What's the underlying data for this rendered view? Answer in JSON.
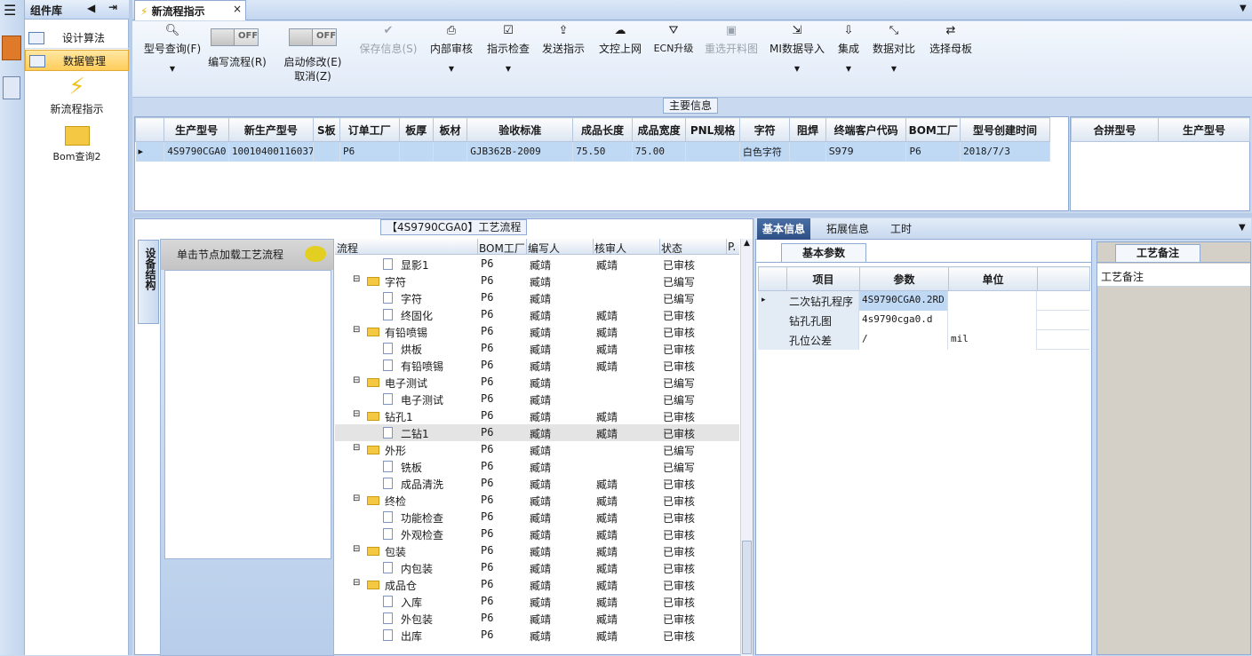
{
  "comp": {
    "title": "组件库",
    "nav": [
      "设计算法",
      "数据管理"
    ],
    "tiles": [
      "新流程指示",
      "Bom查询2"
    ]
  },
  "tab": {
    "title": "新流程指示",
    "close": "×"
  },
  "toolbar": {
    "query": "型号查询(F)",
    "write_flow": "编写流程(R)",
    "start_modify": "启动修改(E)",
    "cancel": "取消(Z)",
    "off": "OFF",
    "save": "保存信息(S)",
    "internal": "内部审核",
    "check": "指示检查",
    "send": "发送指示",
    "upload": "文控上网",
    "ecn": "ECN升级",
    "reselect": "重选开料图",
    "mi_import": "MI数据导入",
    "integrate": "集成",
    "compare": "数据对比",
    "mother": "选择母板"
  },
  "main_info": {
    "title": "主要信息",
    "headers": [
      "生产型号",
      "新生产型号",
      "S板",
      "订单工厂",
      "板厚",
      "板材",
      "验收标准",
      "成品长度",
      "成品宽度",
      "PNL规格",
      "字符",
      "阻焊",
      "终端客户代码",
      "BOM工厂",
      "型号创建时间"
    ],
    "row": [
      "4S9790CGA0",
      "10010400116037",
      "",
      "P6",
      "",
      "",
      "GJB362B-2009",
      "75.50",
      "75.00",
      "",
      "白色字符",
      "",
      "S979",
      "P6",
      "2018/7/3"
    ],
    "right_headers": [
      "合拼型号",
      "生产型号"
    ]
  },
  "process": {
    "title": "【4S9790CGA0】工艺流程",
    "vtab": "设备结构",
    "node_btn": "单击节点加载工艺流程",
    "headers": [
      "流程",
      "BOM工厂",
      "编写人",
      "核审人",
      "状态",
      "P."
    ],
    "rows": [
      {
        "lvl": 2,
        "name": "显影1",
        "bom": "P6",
        "w": "臧靖",
        "r": "臧靖",
        "s": "已审核"
      },
      {
        "lvl": 1,
        "name": "字符",
        "bom": "P6",
        "w": "臧靖",
        "r": "",
        "s": "已编写"
      },
      {
        "lvl": 2,
        "name": "字符",
        "bom": "P6",
        "w": "臧靖",
        "r": "",
        "s": "已编写"
      },
      {
        "lvl": 2,
        "name": "终固化",
        "bom": "P6",
        "w": "臧靖",
        "r": "臧靖",
        "s": "已审核"
      },
      {
        "lvl": 1,
        "name": "有铅喷锡",
        "bom": "P6",
        "w": "臧靖",
        "r": "臧靖",
        "s": "已审核"
      },
      {
        "lvl": 2,
        "name": "烘板",
        "bom": "P6",
        "w": "臧靖",
        "r": "臧靖",
        "s": "已审核"
      },
      {
        "lvl": 2,
        "name": "有铅喷锡",
        "bom": "P6",
        "w": "臧靖",
        "r": "臧靖",
        "s": "已审核"
      },
      {
        "lvl": 1,
        "name": "电子测试",
        "bom": "P6",
        "w": "臧靖",
        "r": "",
        "s": "已编写"
      },
      {
        "lvl": 2,
        "name": "电子测试",
        "bom": "P6",
        "w": "臧靖",
        "r": "",
        "s": "已编写"
      },
      {
        "lvl": 1,
        "name": "钻孔1",
        "bom": "P6",
        "w": "臧靖",
        "r": "臧靖",
        "s": "已审核"
      },
      {
        "lvl": 2,
        "name": "二钻1",
        "bom": "P6",
        "w": "臧靖",
        "r": "臧靖",
        "s": "已审核"
      },
      {
        "lvl": 1,
        "name": "外形",
        "bom": "P6",
        "w": "臧靖",
        "r": "",
        "s": "已编写"
      },
      {
        "lvl": 2,
        "name": "铣板",
        "bom": "P6",
        "w": "臧靖",
        "r": "",
        "s": "已编写"
      },
      {
        "lvl": 2,
        "name": "成品清洗",
        "bom": "P6",
        "w": "臧靖",
        "r": "臧靖",
        "s": "已审核"
      },
      {
        "lvl": 1,
        "name": "终检",
        "bom": "P6",
        "w": "臧靖",
        "r": "臧靖",
        "s": "已审核"
      },
      {
        "lvl": 2,
        "name": "功能检查",
        "bom": "P6",
        "w": "臧靖",
        "r": "臧靖",
        "s": "已审核"
      },
      {
        "lvl": 2,
        "name": "外观检查",
        "bom": "P6",
        "w": "臧靖",
        "r": "臧靖",
        "s": "已审核"
      },
      {
        "lvl": 1,
        "name": "包装",
        "bom": "P6",
        "w": "臧靖",
        "r": "臧靖",
        "s": "已审核"
      },
      {
        "lvl": 2,
        "name": "内包装",
        "bom": "P6",
        "w": "臧靖",
        "r": "臧靖",
        "s": "已审核"
      },
      {
        "lvl": 1,
        "name": "成品仓",
        "bom": "P6",
        "w": "臧靖",
        "r": "臧靖",
        "s": "已审核"
      },
      {
        "lvl": 2,
        "name": "入库",
        "bom": "P6",
        "w": "臧靖",
        "r": "臧靖",
        "s": "已审核"
      },
      {
        "lvl": 2,
        "name": "外包装",
        "bom": "P6",
        "w": "臧靖",
        "r": "臧靖",
        "s": "已审核"
      },
      {
        "lvl": 2,
        "name": "出库",
        "bom": "P6",
        "w": "臧靖",
        "r": "臧靖",
        "s": "已审核"
      }
    ]
  },
  "right_tabs": [
    "基本信息",
    "拓展信息",
    "工时"
  ],
  "basic": {
    "tab": "基本参数",
    "headers": [
      "项目",
      "参数",
      "单位"
    ],
    "rows": [
      [
        "二次钻孔程序",
        "4S9790CGA0.2RD",
        ""
      ],
      [
        "钻孔孔图",
        "4s9790cga0.d",
        ""
      ],
      [
        "孔位公差",
        "/",
        "mil"
      ]
    ]
  },
  "note": {
    "tab": "工艺备注",
    "label": "工艺备注"
  }
}
